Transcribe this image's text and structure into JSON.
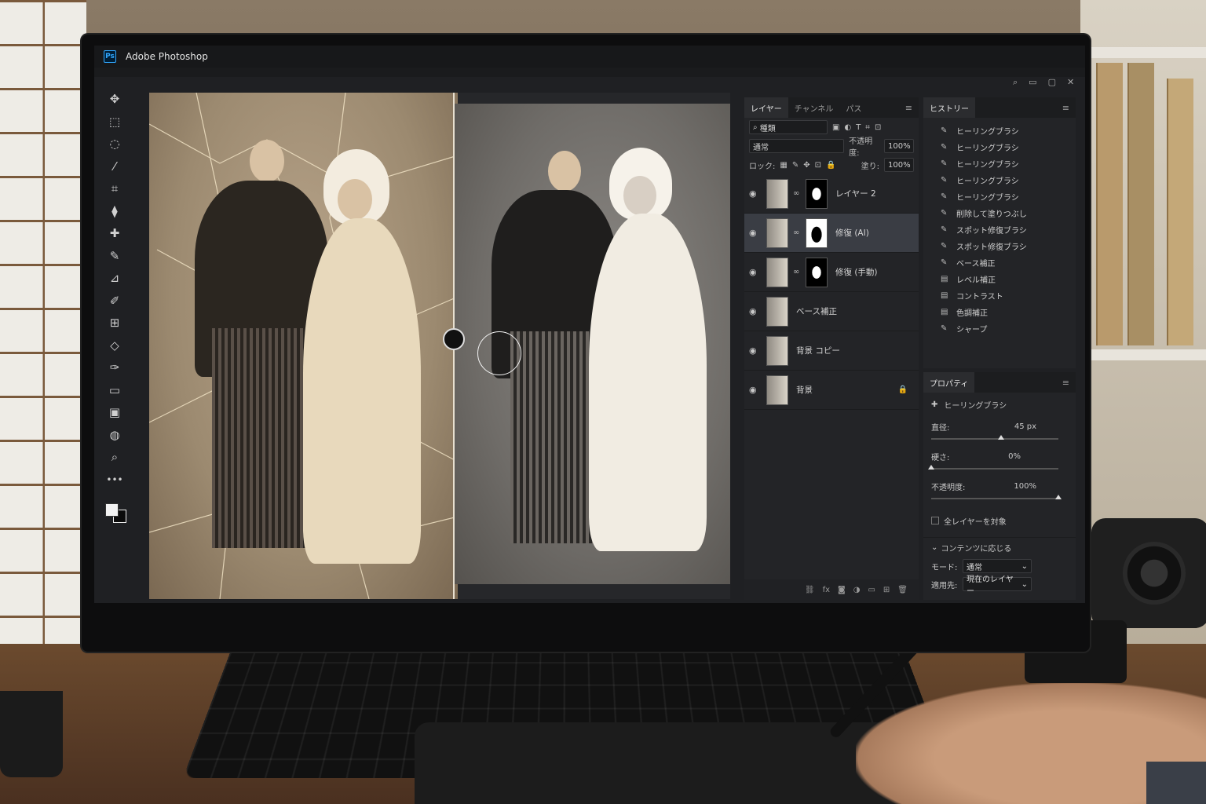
{
  "app": {
    "title": "Adobe Photoshop",
    "logo_text": "Ps"
  },
  "window_controls": [
    "⌕",
    "▭",
    "▢",
    "✕"
  ],
  "toolbar": {
    "tools": [
      "✥",
      "⬚",
      "◌",
      "⁄",
      "⌗",
      "⧫",
      "✚",
      "✎",
      "⊿",
      "✐",
      "⊞",
      "◇",
      "✑",
      "▭",
      "▣",
      "◍",
      "⌕",
      "•••"
    ]
  },
  "layers_panel": {
    "tabs": [
      "レイヤー",
      "チャンネル",
      "パス"
    ],
    "active_tab": "レイヤー",
    "filter_value": "種類",
    "blend_mode": "通常",
    "opacity_label": "不透明度:",
    "opacity_value": "100%",
    "lock_label": "ロック:",
    "fill_label": "塗り:",
    "fill_value": "100%",
    "layers": [
      {
        "name": "レイヤー 2",
        "visible": true,
        "has_mask": true,
        "selected": false,
        "locked": false
      },
      {
        "name": "修復 (AI)",
        "visible": true,
        "has_mask": true,
        "selected": true,
        "locked": false
      },
      {
        "name": "修復 (手動)",
        "visible": true,
        "has_mask": true,
        "selected": false,
        "locked": false
      },
      {
        "name": "ベース補正",
        "visible": true,
        "has_mask": false,
        "selected": false,
        "locked": false
      },
      {
        "name": "背景 コピー",
        "visible": true,
        "has_mask": false,
        "selected": false,
        "locked": false
      },
      {
        "name": "背景",
        "visible": true,
        "has_mask": false,
        "selected": false,
        "locked": true
      }
    ]
  },
  "history_panel": {
    "title": "ヒストリー",
    "items": [
      {
        "icon": "brush",
        "label": "ヒーリングブラシ"
      },
      {
        "icon": "brush",
        "label": "ヒーリングブラシ"
      },
      {
        "icon": "brush",
        "label": "ヒーリングブラシ"
      },
      {
        "icon": "brush",
        "label": "ヒーリングブラシ"
      },
      {
        "icon": "brush",
        "label": "ヒーリングブラシ"
      },
      {
        "icon": "brush",
        "label": "削除して塗りつぶし"
      },
      {
        "icon": "brush",
        "label": "スポット修復ブラシ"
      },
      {
        "icon": "brush",
        "label": "スポット修復ブラシ"
      },
      {
        "icon": "brush",
        "label": "ベース補正"
      },
      {
        "icon": "adjust",
        "label": "レベル補正"
      },
      {
        "icon": "adjust",
        "label": "コントラスト"
      },
      {
        "icon": "adjust",
        "label": "色調補正"
      },
      {
        "icon": "brush",
        "label": "シャープ"
      }
    ]
  },
  "properties_panel": {
    "title": "プロパティ",
    "tool_name": "ヒーリングブラシ",
    "diameter_label": "直径:",
    "diameter_value": "45 px",
    "diameter_level": 0.55,
    "hardness_label": "硬さ:",
    "hardness_value": "0%",
    "hardness_level": 0.0,
    "opacity_label": "不透明度:",
    "opacity_value": "100%",
    "opacity_level": 1.0,
    "all_layers_label": "全レイヤーを対象",
    "all_layers_checked": false,
    "content_aware_label": "コンテンツに応じる",
    "mode_label": "モード:",
    "mode_value": "通常",
    "sample_label": "適用先:",
    "sample_value": "現在のレイヤー"
  },
  "colors": {
    "accent": "#31a8ff",
    "panel_bg": "#232427",
    "selected_layer": "#3a3d44"
  }
}
